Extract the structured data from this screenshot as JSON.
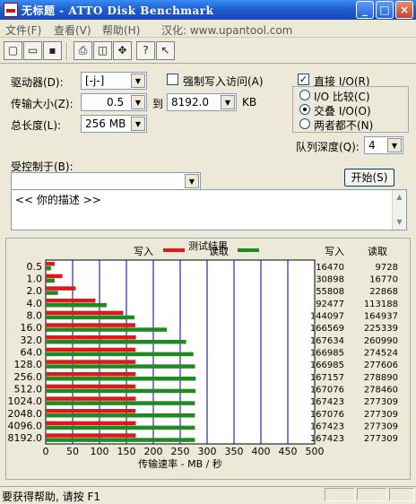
{
  "window": {
    "title": "无标题 - ATTO Disk Benchmark",
    "controls": {
      "minimize": "_",
      "maximize": "□",
      "close": "×"
    }
  },
  "menubar": {
    "items": [
      "文件(F)",
      "查看(V)",
      "帮助(H)",
      "汉化: www.upantool.com"
    ]
  },
  "toolbar": {
    "icons": [
      "new-document-icon",
      "open-folder-icon",
      "save-icon",
      "print-icon",
      "print-preview-icon",
      "move-icon",
      "help-icon",
      "context-help-icon"
    ]
  },
  "settings": {
    "drive_label": "驱动器(D):",
    "drive_value": "[-j-]",
    "transfer_label": "传输大小(Z):",
    "transfer_from": "0.5",
    "to_label": "到",
    "transfer_to": "8192.0",
    "unit": "KB",
    "length_label": "总长度(L):",
    "length_value": "256 MB",
    "force_write_label": "强制写入访问(A)",
    "force_write_checked": false,
    "direct_io_label": "直接 I/O(R)",
    "direct_io_checked": true,
    "io_compare_label": "I/O 比较(C)",
    "overlapped_label": "交叠 I/O(O)",
    "neither_label": "两者都不(N)",
    "io_mode": "overlapped",
    "queue_label": "队列深度(Q):",
    "queue_value": "4",
    "controlled_label": "受控制于(B):",
    "controlled_value": "",
    "start_button": "开始(S)",
    "description": "<< 你的描述 >>"
  },
  "status": {
    "text": "要获得帮助, 请按 F1"
  },
  "chart_data": {
    "type": "bar",
    "orientation": "horizontal",
    "title": "测试结果",
    "xlabel": "传输速率 - MB / 秒",
    "xlim": [
      0,
      500
    ],
    "xticks": [
      0,
      50,
      100,
      150,
      200,
      250,
      300,
      350,
      400,
      450,
      500
    ],
    "categories": [
      "0.5",
      "1.0",
      "2.0",
      "4.0",
      "8.0",
      "16.0",
      "32.0",
      "64.0",
      "128.0",
      "256.0",
      "512.0",
      "1024.0",
      "2048.0",
      "4096.0",
      "8192.0"
    ],
    "series": [
      {
        "name": "写入",
        "color": "#dd1a1a",
        "values": [
          16470,
          30898,
          55808,
          92477,
          144097,
          166569,
          167634,
          166985,
          166985,
          167157,
          167076,
          167423,
          167076,
          167423,
          167423
        ]
      },
      {
        "name": "读取",
        "color": "#1f8a1f",
        "values": [
          9728,
          16770,
          22868,
          113188,
          164937,
          225339,
          260990,
          274524,
          277606,
          278890,
          278460,
          277309,
          277309,
          277309,
          277309
        ]
      }
    ],
    "column_headers": [
      "写入",
      "读取"
    ],
    "grid": true
  }
}
